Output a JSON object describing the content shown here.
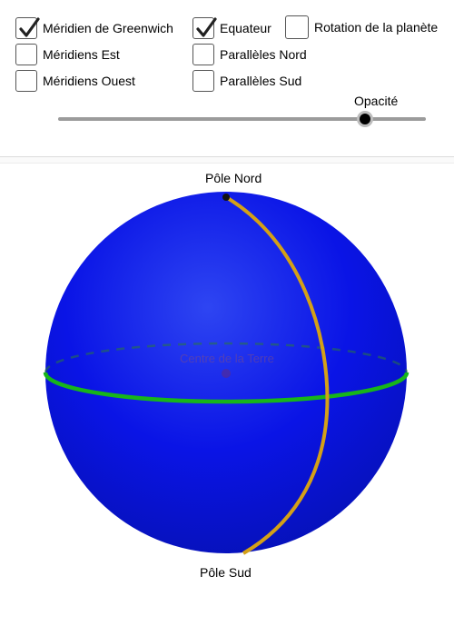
{
  "controls": {
    "greenwich": {
      "label": "Méridien de Greenwich",
      "checked": true
    },
    "equator": {
      "label": "Equateur",
      "checked": true
    },
    "rotation": {
      "label": "Rotation de la planète",
      "checked": false
    },
    "meridians_east": {
      "label": "Méridiens Est",
      "checked": false
    },
    "parallels_north": {
      "label": "Parallèles Nord",
      "checked": false
    },
    "meridians_west": {
      "label": "Méridiens Ouest",
      "checked": false
    },
    "parallels_south": {
      "label": "Parallèles Sud",
      "checked": false
    }
  },
  "opacity": {
    "label": "Opacité",
    "value": 0.84
  },
  "scene": {
    "north_pole_label": "Pôle Nord",
    "south_pole_label": "Pôle Sud",
    "center_label": "Centre de la Terre",
    "colors": {
      "sphere": "#0a14e6",
      "meridian": "#d4a017",
      "equator": "#17b51a"
    }
  }
}
